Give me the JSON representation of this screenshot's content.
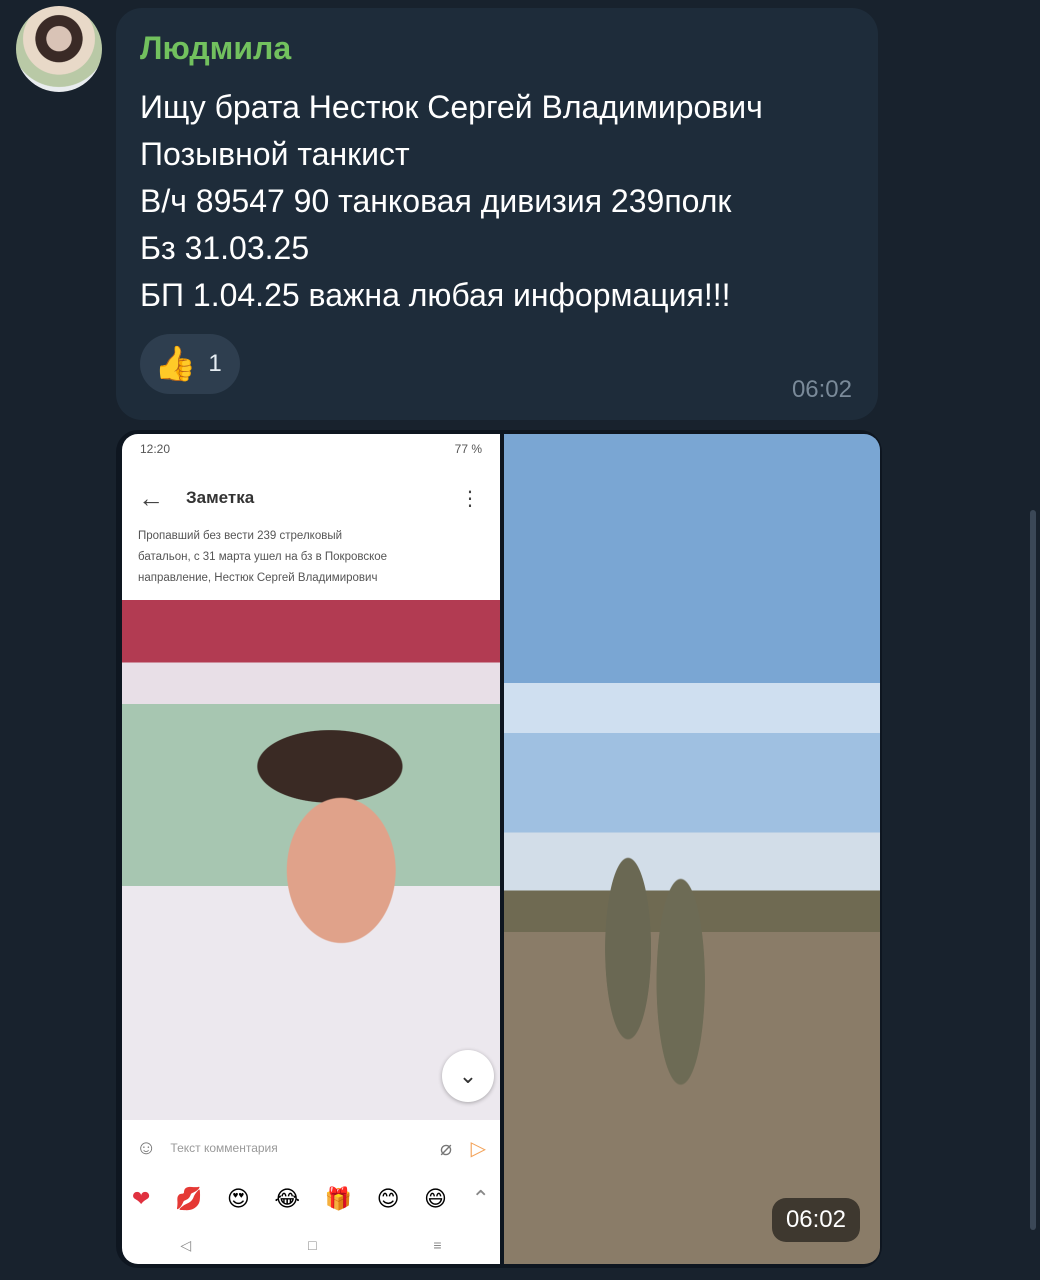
{
  "message": {
    "sender": "Людмила",
    "lines": [
      "Ищу брата Нестюк Сергей Владимирович",
      "Позывной танкист",
      "В/ч 89547 90 танковая дивизия 239полк",
      "Бз 31.03.25",
      "БП 1.04.25 важна любая информация!!!"
    ],
    "reaction": {
      "emoji": "👍",
      "count": "1"
    },
    "time": "06:02"
  },
  "media": {
    "screenshot": {
      "status_time": "12:20",
      "status_right": "77 %",
      "title": "Заметка",
      "note_lines": [
        "Пропавший без вести 239 стрелковый",
        "батальон, с 31 марта ушел на бз в Покровское",
        "направление, Нестюк Сергей Владимирович"
      ],
      "comment_placeholder": "Текст комментария",
      "emojis": [
        "❤",
        "💋",
        "😍",
        "😂",
        "🎁",
        "😊",
        "😄",
        "⌃"
      ],
      "nav": [
        "◁",
        "□",
        "≡"
      ]
    },
    "time": "06:02"
  },
  "colors": {
    "background": "#18222d",
    "bubble": "#1e2c3a",
    "sender": "#72c15e"
  }
}
